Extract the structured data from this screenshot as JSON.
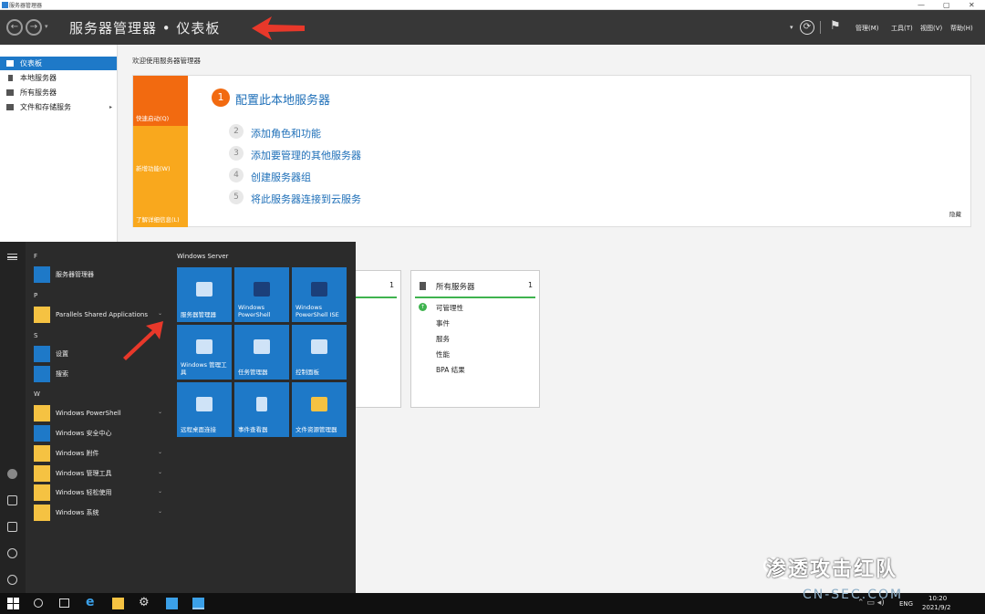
{
  "window": {
    "title": "服务器管理器",
    "min": "—",
    "max": "▢",
    "close": "✕"
  },
  "header": {
    "back": "←",
    "forward": "→",
    "dropdown": "▾",
    "title": "服务器管理器 • 仪表板",
    "refresh": "⟳",
    "flag": "⚑",
    "menus": [
      "管理(M)",
      "工具(T)",
      "视图(V)",
      "帮助(H)"
    ]
  },
  "sidebar": {
    "items": [
      {
        "label": "仪表板"
      },
      {
        "label": "本地服务器"
      },
      {
        "label": "所有服务器"
      },
      {
        "label": "文件和存储服务",
        "chevron": "▸"
      }
    ]
  },
  "main": {
    "welcome": "欢迎使用服务器管理器",
    "quickstart": {
      "blocks": [
        "快速启动(Q)",
        "新增功能(W)",
        "了解详细信息(L)"
      ],
      "primary_num": "1",
      "primary": "配置此本地服务器",
      "steps": [
        {
          "num": "2",
          "label": "添加角色和功能"
        },
        {
          "num": "3",
          "label": "添加要管理的其他服务器"
        },
        {
          "num": "4",
          "label": "创建服务器组"
        },
        {
          "num": "5",
          "label": "将此服务器连接到云服务"
        }
      ],
      "hide": "隐藏"
    },
    "card1": {
      "count": "1"
    },
    "card2": {
      "title": "所有服务器",
      "count": "1",
      "rows": [
        "可管理性",
        "事件",
        "服务",
        "性能",
        "BPA 结果"
      ]
    }
  },
  "startmenu": {
    "tiles_header": "Windows Server",
    "letters": [
      "F",
      "P",
      "S",
      "W"
    ],
    "apps": [
      {
        "label": "服务器管理器"
      },
      {
        "label": "Parallels Shared Applications",
        "chevron": "⌄"
      },
      {
        "label": "设置"
      },
      {
        "label": "搜索"
      },
      {
        "label": "Windows PowerShell",
        "chevron": "⌄"
      },
      {
        "label": "Windows 安全中心"
      },
      {
        "label": "Windows 附件",
        "chevron": "⌄"
      },
      {
        "label": "Windows 管理工具",
        "chevron": "⌄"
      },
      {
        "label": "Windows 轻松使用",
        "chevron": "⌄"
      },
      {
        "label": "Windows 系统",
        "chevron": "⌄"
      }
    ],
    "tiles": [
      "服务器管理器",
      "Windows PowerShell",
      "Windows PowerShell ISE",
      "Windows 管理工具",
      "任务管理器",
      "控制面板",
      "远程桌面连接",
      "事件查看器",
      "文件资源管理器"
    ]
  },
  "taskbar": {
    "lang": "ENG",
    "time": "10:20",
    "date": "2021/9/2"
  },
  "watermark": {
    "text": "渗透攻击红队",
    "sub": "CN-SEC.COM"
  }
}
